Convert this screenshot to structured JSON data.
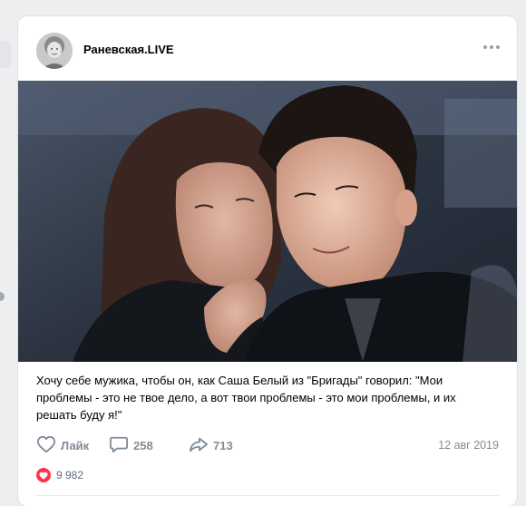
{
  "post": {
    "author": "Раневская.LIVE",
    "text": "Хочу себе мужика, чтобы он, как Саша Белый из \"Бригады\" говорил: \"Мои проблемы - это не твое дело, а вот твои проблемы - это мои проблемы, и их решать буду я!\"",
    "date": "12 авг 2019"
  },
  "actions": {
    "like_label": "Лайк",
    "comments_count": "258",
    "shares_count": "713"
  },
  "reactions": {
    "likes_count": "9 982"
  },
  "icons": {
    "like": "heart-outline-icon",
    "comment": "comment-bubble-icon",
    "share": "share-arrow-icon",
    "more": "more-dots-icon",
    "reaction": "heart-filled-icon"
  },
  "colors": {
    "accent_red": "#ff3347",
    "secondary_text": "#818c99",
    "page_bg": "#edeef0"
  }
}
